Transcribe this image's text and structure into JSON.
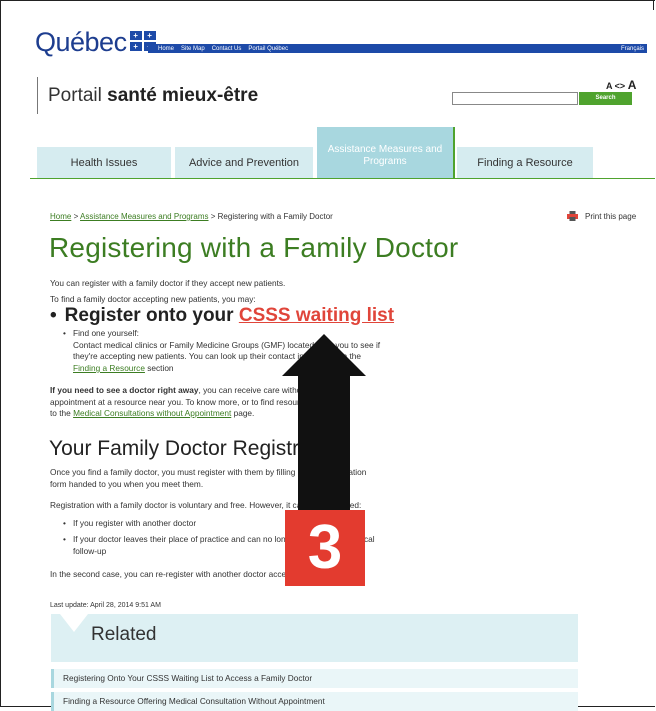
{
  "header": {
    "logo_text": "Québec",
    "logo_flag_glyph": "+",
    "topbar_links": [
      "Home",
      "Site Map",
      "Contact Us",
      "Portail Québec"
    ],
    "language": "Français",
    "portal_prefix": "Portail ",
    "portal_bold": "santé mieux-être",
    "font_size_small": "A <> ",
    "font_size_big": "A",
    "search_placeholder": "",
    "search_button": "Search"
  },
  "tabs": [
    {
      "label": "Health Issues",
      "active": false
    },
    {
      "label": "Advice and Prevention",
      "active": false
    },
    {
      "label": "Assistance Measures and Programs",
      "active": true
    },
    {
      "label": "Finding a Resource",
      "active": false
    }
  ],
  "breadcrumb": {
    "home": "Home",
    "sep": " > ",
    "section": "Assistance Measures and Programs",
    "current": "Registering with a Family Doctor"
  },
  "print_label": "Print this page",
  "page_title": "Registering with a Family Doctor",
  "intro": {
    "line1": "You can register with a family doctor if they accept new patients.",
    "line2": "To find a family doctor accepting new patients, you may:"
  },
  "big_bullet": {
    "text": "Register onto your ",
    "link": "CSSS waiting list"
  },
  "find_yourself": {
    "label": "Find one yourself:",
    "line1": "Contact medical clinics or Family Medicine Groups (GMF) located near you to see if",
    "line2": "they're accepting new patients. You can look up their contact information in the",
    "link": "Finding a Resource",
    "tail": " section"
  },
  "right_away": {
    "bold": "If you need to see a doctor right away",
    "rest1": ", you can receive care without",
    "line2": "appointment at a resource near you. To know more, or to find resources, go",
    "line3_pre": "to the ",
    "link": "Medical Consultations without Appointment",
    "line3_post": " page."
  },
  "section2": {
    "heading": "Your Family Doctor Registration",
    "p1_line1": "Once you find a family doctor, you must register with them by filling out the registration",
    "p1_line2": "form handed to you when you meet them.",
    "p2": "Registration with a family doctor is voluntary and free. However, it can be terminated:",
    "bullet1": "If you register with another doctor",
    "bullet2_line1": "If your doctor leaves their place of practice and can no longer ensure your medical",
    "bullet2_line2": "follow-up",
    "p3": "In the second case, you can re-register with another doctor accepting new patients."
  },
  "last_update": "Last update: April 28, 2014 9:51 AM",
  "related": {
    "title": "Related",
    "items": [
      "Registering Onto Your CSSS Waiting List to Access a Family Doctor",
      "Finding a Resource Offering Medical Consultation Without Appointment"
    ]
  },
  "overlay": {
    "number": "3",
    "arrow_color": "#111111",
    "badge_color": "#e33b2f"
  },
  "colors": {
    "brand_blue": "#1d4aa8",
    "green": "#3c7d22",
    "tab_bg": "#d6ecf0",
    "tab_active_bg": "#a8d7df",
    "link_red": "#e0453a"
  }
}
